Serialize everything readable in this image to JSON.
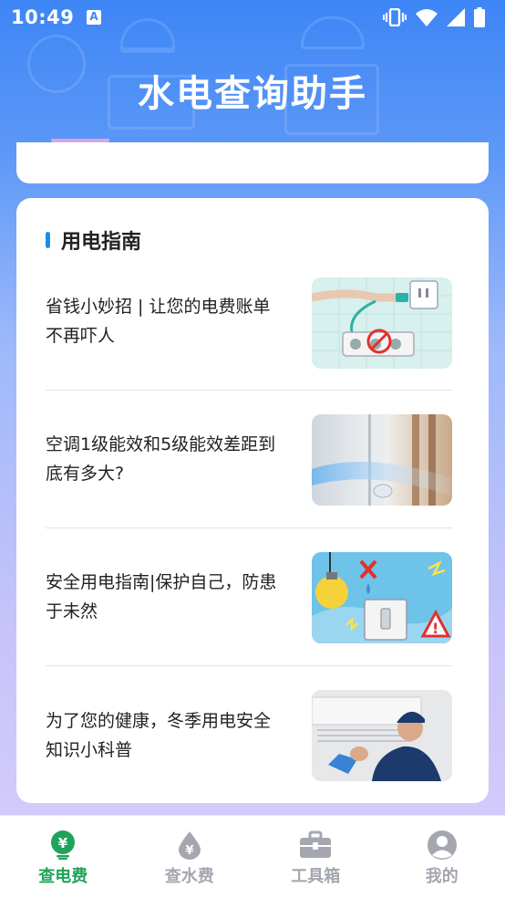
{
  "status_bar": {
    "time": "10:49",
    "notification_icon": "a-icon",
    "right_icons": [
      "vibrate-icon",
      "wifi-icon",
      "signal-icon",
      "battery-icon"
    ]
  },
  "app": {
    "title": "水电查询助手"
  },
  "guide": {
    "title": "用电指南",
    "accent_color": "#1a8cf0",
    "articles": [
      {
        "title": "省钱小妙招 | 让您的电费账单不再吓人",
        "thumb": "power-strip-image"
      },
      {
        "title": "空调1级能效和5级能效差距到底有多大?",
        "thumb": "air-conditioner-image"
      },
      {
        "title": "安全用电指南|保护自己，防患于未然",
        "thumb": "electric-safety-image"
      },
      {
        "title": "为了您的健康，冬季用电安全知识小科普",
        "thumb": "ac-repair-image"
      }
    ]
  },
  "tabs": [
    {
      "label": "查电费",
      "icon": "electricity-fee-icon",
      "active": true
    },
    {
      "label": "查水费",
      "icon": "water-fee-icon",
      "active": false
    },
    {
      "label": "工具箱",
      "icon": "toolbox-icon",
      "active": false
    },
    {
      "label": "我的",
      "icon": "profile-icon",
      "active": false
    }
  ],
  "colors": {
    "active_tab": "#1fa35a",
    "inactive_tab": "#a4a7b0",
    "header_blue": "#3d86f6"
  }
}
